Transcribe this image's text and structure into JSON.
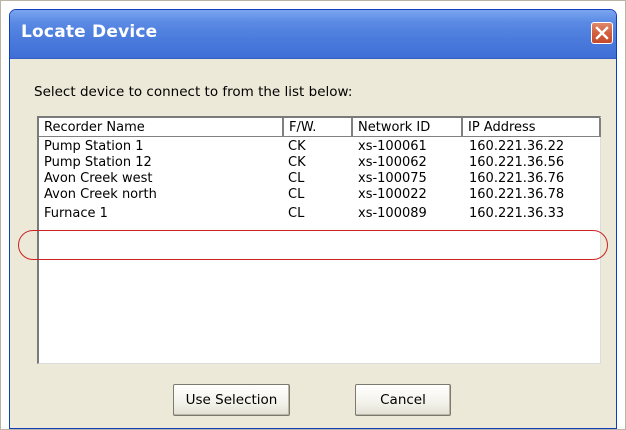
{
  "window": {
    "title": "Locate Device",
    "close_label": "Close"
  },
  "prompt": "Select device to connect to from the list below:",
  "list": {
    "columns": [
      "Recorder Name",
      "F/W.",
      "Network ID",
      "IP Address"
    ],
    "rows": [
      {
        "name": "Pump Station 1",
        "fw": "CK",
        "network_id": "xs-100061",
        "ip": "160.221.36.22"
      },
      {
        "name": "Pump Station 12",
        "fw": "CK",
        "network_id": "xs-100062",
        "ip": "160.221.36.56"
      },
      {
        "name": "Avon Creek west",
        "fw": "CL",
        "network_id": "xs-100075",
        "ip": "160.221.36.76"
      },
      {
        "name": "Avon Creek north",
        "fw": "CL",
        "network_id": "xs-100022",
        "ip": "160.221.36.78"
      },
      {
        "name": "Furnace 1",
        "fw": "CL",
        "network_id": "xs-100089",
        "ip": "160.221.36.33"
      }
    ],
    "highlighted_row": 4
  },
  "buttons": {
    "use_selection": "Use Selection",
    "cancel": "Cancel"
  },
  "colors": {
    "titlebar": "#4b7bdc",
    "close_button": "#d2603f",
    "annotation_ring": "#cc2222",
    "dialog_background": "#ece9d8"
  }
}
